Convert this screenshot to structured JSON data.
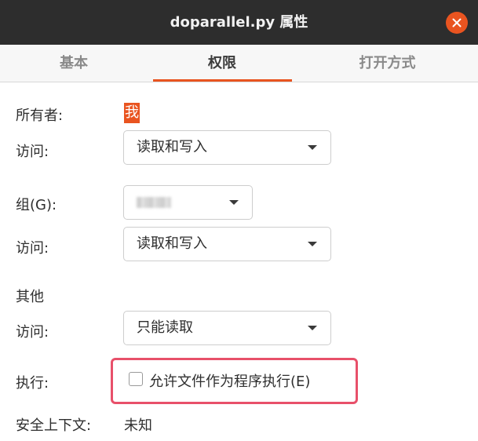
{
  "window": {
    "title": "doparallel.py 属性"
  },
  "tabs": [
    {
      "label": "基本",
      "active": false
    },
    {
      "label": "权限",
      "active": true
    },
    {
      "label": "打开方式",
      "active": false
    }
  ],
  "permissions": {
    "owner_label": "所有者:",
    "owner_value": "我",
    "owner_access_label": "访问:",
    "owner_access_value": "读取和写入",
    "group_label": "组(G):",
    "group_access_label": "访问:",
    "group_access_value": "读取和写入",
    "others_label": "其他",
    "others_access_label": "访问:",
    "others_access_value": "只能读取",
    "execute_label": "执行:",
    "execute_checkbox_label": "允许文件作为程序执行(E)",
    "execute_checked": false,
    "security_context_label": "安全上下文:",
    "security_context_value": "未知"
  },
  "colors": {
    "accent": "#e95420",
    "titlebar": "#2d2d2d",
    "highlight_annotation": "#e8506a"
  },
  "icons": {
    "close": "close-icon",
    "dropdown": "chevron-down-icon"
  }
}
